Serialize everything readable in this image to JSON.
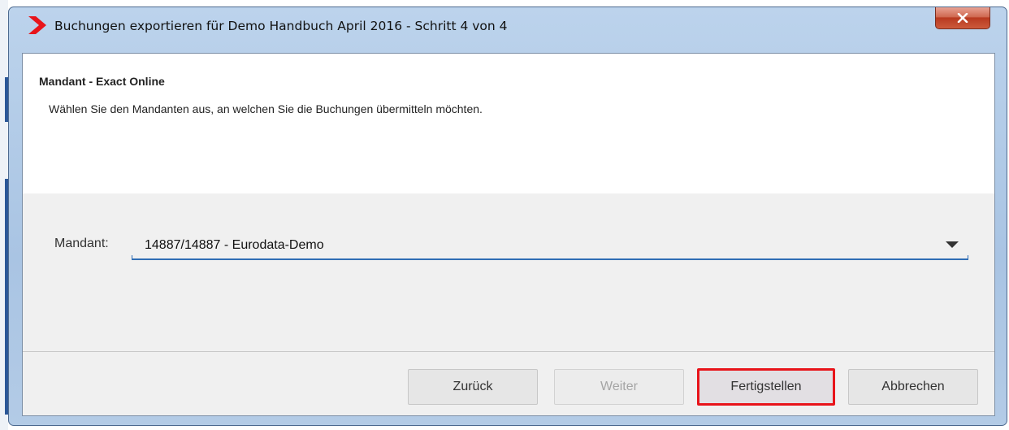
{
  "window": {
    "title": "Buchungen exportieren für Demo Handbuch April 2016 - Schritt 4 von 4",
    "close_icon": "close-icon",
    "app_icon": "red-chevron-icon",
    "accent": "#e8141a"
  },
  "header": {
    "title": "Mandant - Exact Online",
    "description": "Wählen Sie den Mandanten aus, an welchen Sie die Buchungen übermitteln möchten."
  },
  "form": {
    "mandant_label": "Mandant:",
    "mandant_value": "14887/14887 - Eurodata-Demo"
  },
  "buttons": {
    "back": "Zurück",
    "next": "Weiter",
    "finish": "Fertigstellen",
    "cancel": "Abbrechen"
  }
}
